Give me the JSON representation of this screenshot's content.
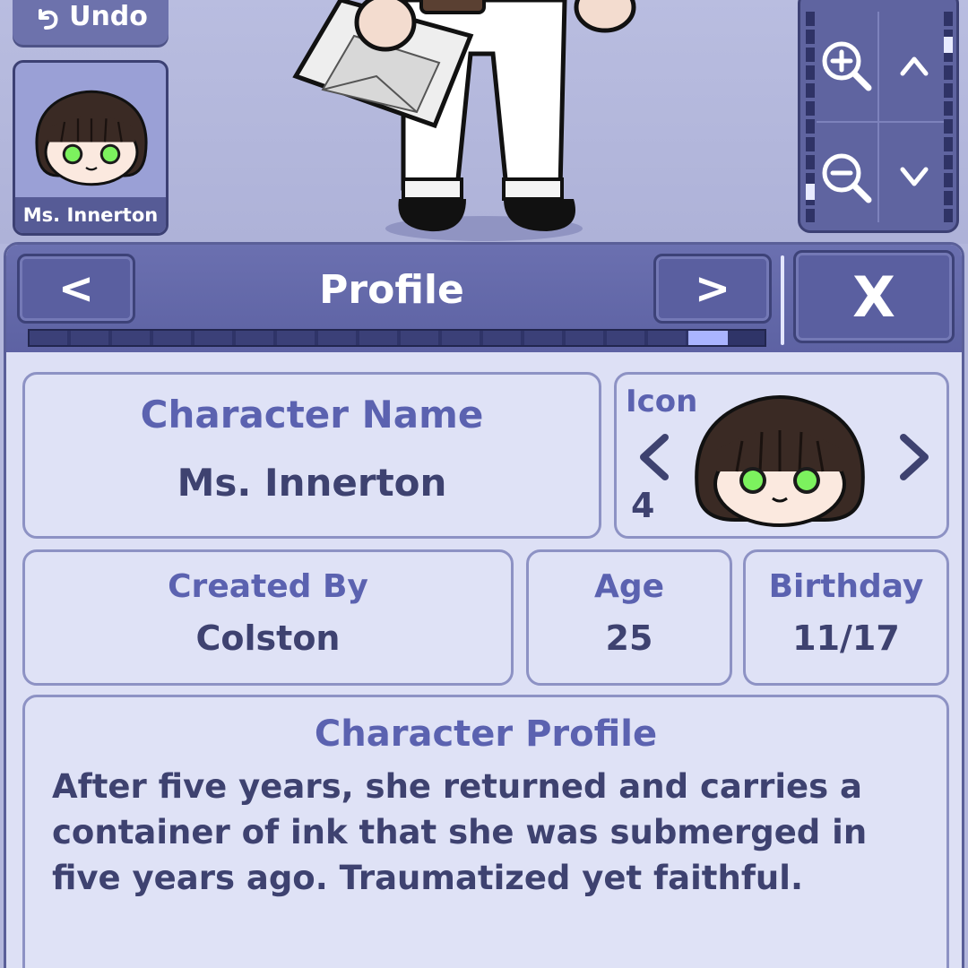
{
  "toolbar": {
    "undo_label": "Undo"
  },
  "character_card": {
    "name": "Ms. Innerton"
  },
  "zoom_panel": {
    "zoom_in": "zoom-in-icon",
    "zoom_out": "zoom-out-icon",
    "up": "chevron-up-icon",
    "down": "chevron-down-icon"
  },
  "panel": {
    "prev_label": "<",
    "title": "Profile",
    "next_label": ">",
    "close_label": "X",
    "progress_fraction": 0.95
  },
  "profile": {
    "name_label": "Character Name",
    "name_value": "Ms. Innerton",
    "icon_label": "Icon",
    "icon_prev": "<",
    "icon_next": ">",
    "icon_number": "4",
    "created_by_label": "Created By",
    "created_by_value": "Colston",
    "age_label": "Age",
    "age_value": "25",
    "birthday_label": "Birthday",
    "birthday_value": "11/17",
    "bio_label": "Character Profile",
    "bio_text": "After five years, she returned and carries a container of ink that she was submerged in five years ago. Traumatized yet faithful."
  },
  "colors": {
    "accent": "#5b62b0",
    "panel_bg": "#dde0f5",
    "header_bg": "#6b70b0",
    "text_dark": "#3e4270"
  }
}
